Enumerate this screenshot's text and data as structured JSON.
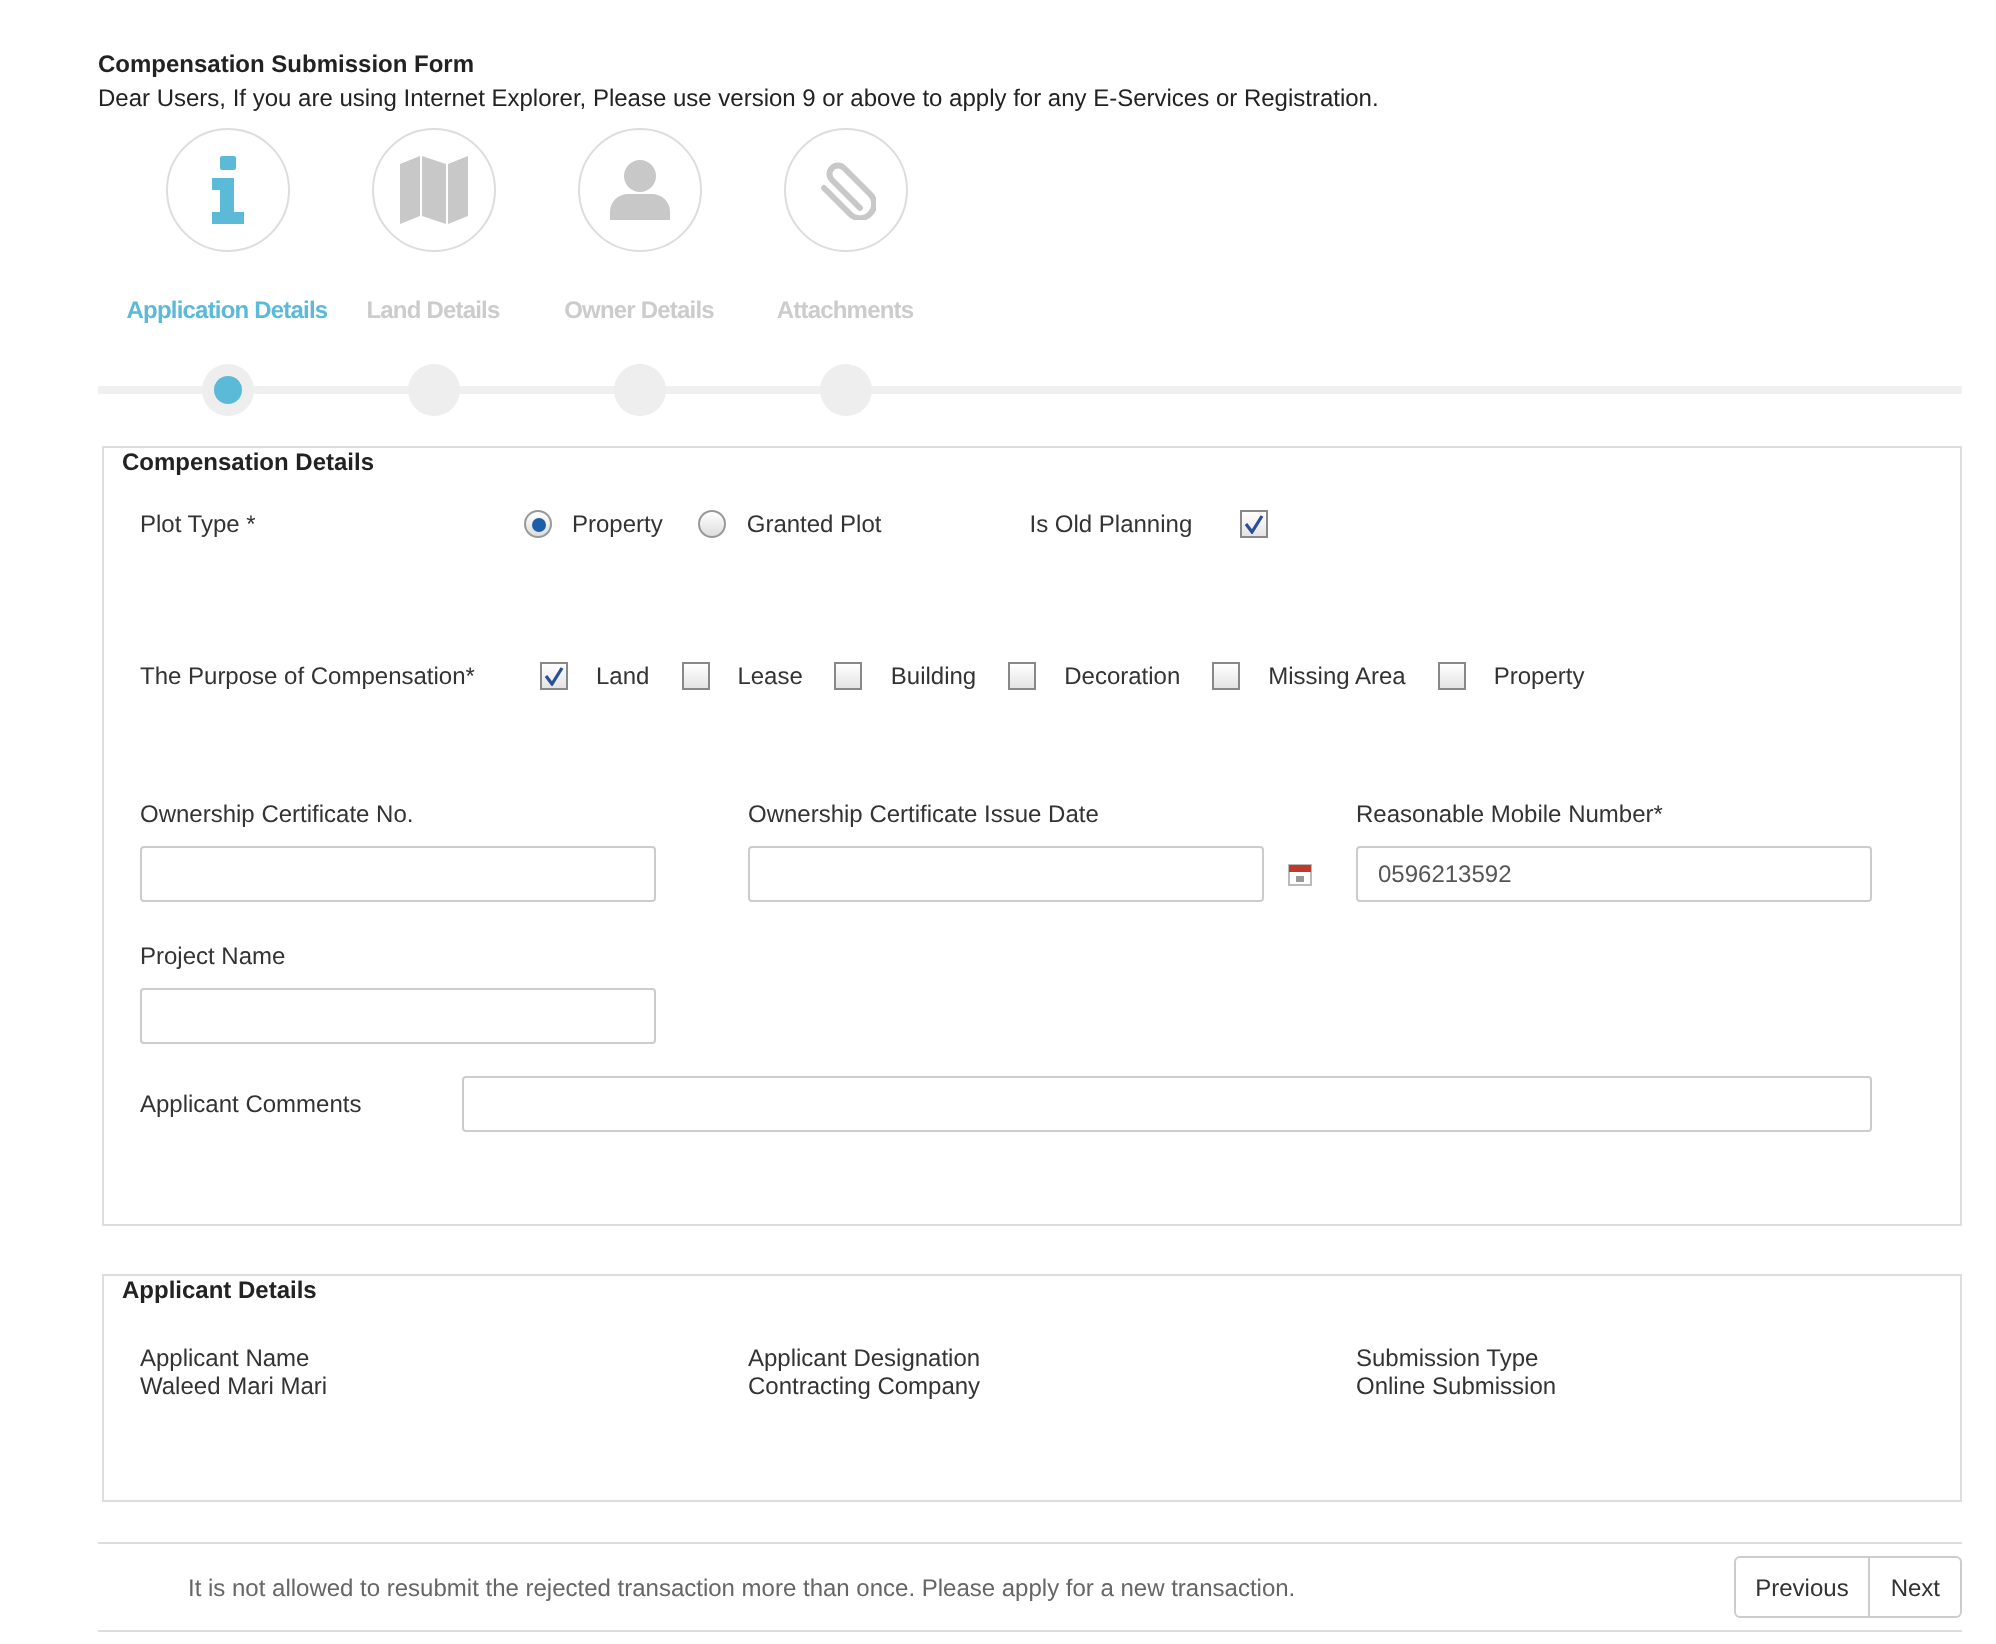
{
  "form": {
    "title": "Compensation Submission Form",
    "notice": "Dear Users, If you are using Internet Explorer, Please use version 9 or above to apply for any E-Services or Registration."
  },
  "steps": [
    {
      "label": "Application Details",
      "kind": "info",
      "selected": true
    },
    {
      "label": "Land Details",
      "kind": "map",
      "selected": false
    },
    {
      "label": "Owner Details",
      "kind": "person",
      "selected": false
    },
    {
      "label": "Attachments",
      "kind": "paperclip",
      "selected": false
    }
  ],
  "compensation_details": {
    "legend": "Compensation Details",
    "plot_type": {
      "label": "Plot Type *",
      "options": [
        {
          "label": "Property",
          "selected": true
        },
        {
          "label": "Granted Plot",
          "selected": false
        }
      ]
    },
    "old_planning": {
      "label": "Is Old Planning",
      "checked": true
    },
    "purpose": {
      "label": "The Purpose of Compensation*",
      "options": [
        {
          "label": "Land",
          "checked": true
        },
        {
          "label": "Lease",
          "checked": false
        },
        {
          "label": "Building",
          "checked": false
        },
        {
          "label": "Decoration",
          "checked": false
        },
        {
          "label": "Missing Area",
          "checked": false
        },
        {
          "label": "Property",
          "checked": false
        }
      ]
    },
    "fields": [
      {
        "label": "Ownership Certificate No.",
        "kind": "text"
      },
      {
        "label": "Ownership Certificate Issue Date",
        "kind": "date"
      },
      {
        "label": "Reasonable Mobile Number*",
        "kind": "text",
        "value": "0596213592"
      },
      {
        "label": "Project Name",
        "kind": "text"
      },
      {
        "label": "Applicant Comments",
        "kind": "comment"
      }
    ]
  },
  "applicant_details": {
    "legend": "Applicant Details",
    "items": [
      {
        "label": "Applicant Name",
        "value": "Waleed Mari Mari"
      },
      {
        "label": "Applicant Designation",
        "value": "Contracting Company"
      },
      {
        "label": "Submission Type",
        "value": "Online Submission"
      }
    ]
  },
  "footer": {
    "note": "It is not allowed to resubmit the rejected transaction more than once. Please apply for a new transaction.",
    "buttons": [
      "Previous",
      "Next"
    ]
  }
}
